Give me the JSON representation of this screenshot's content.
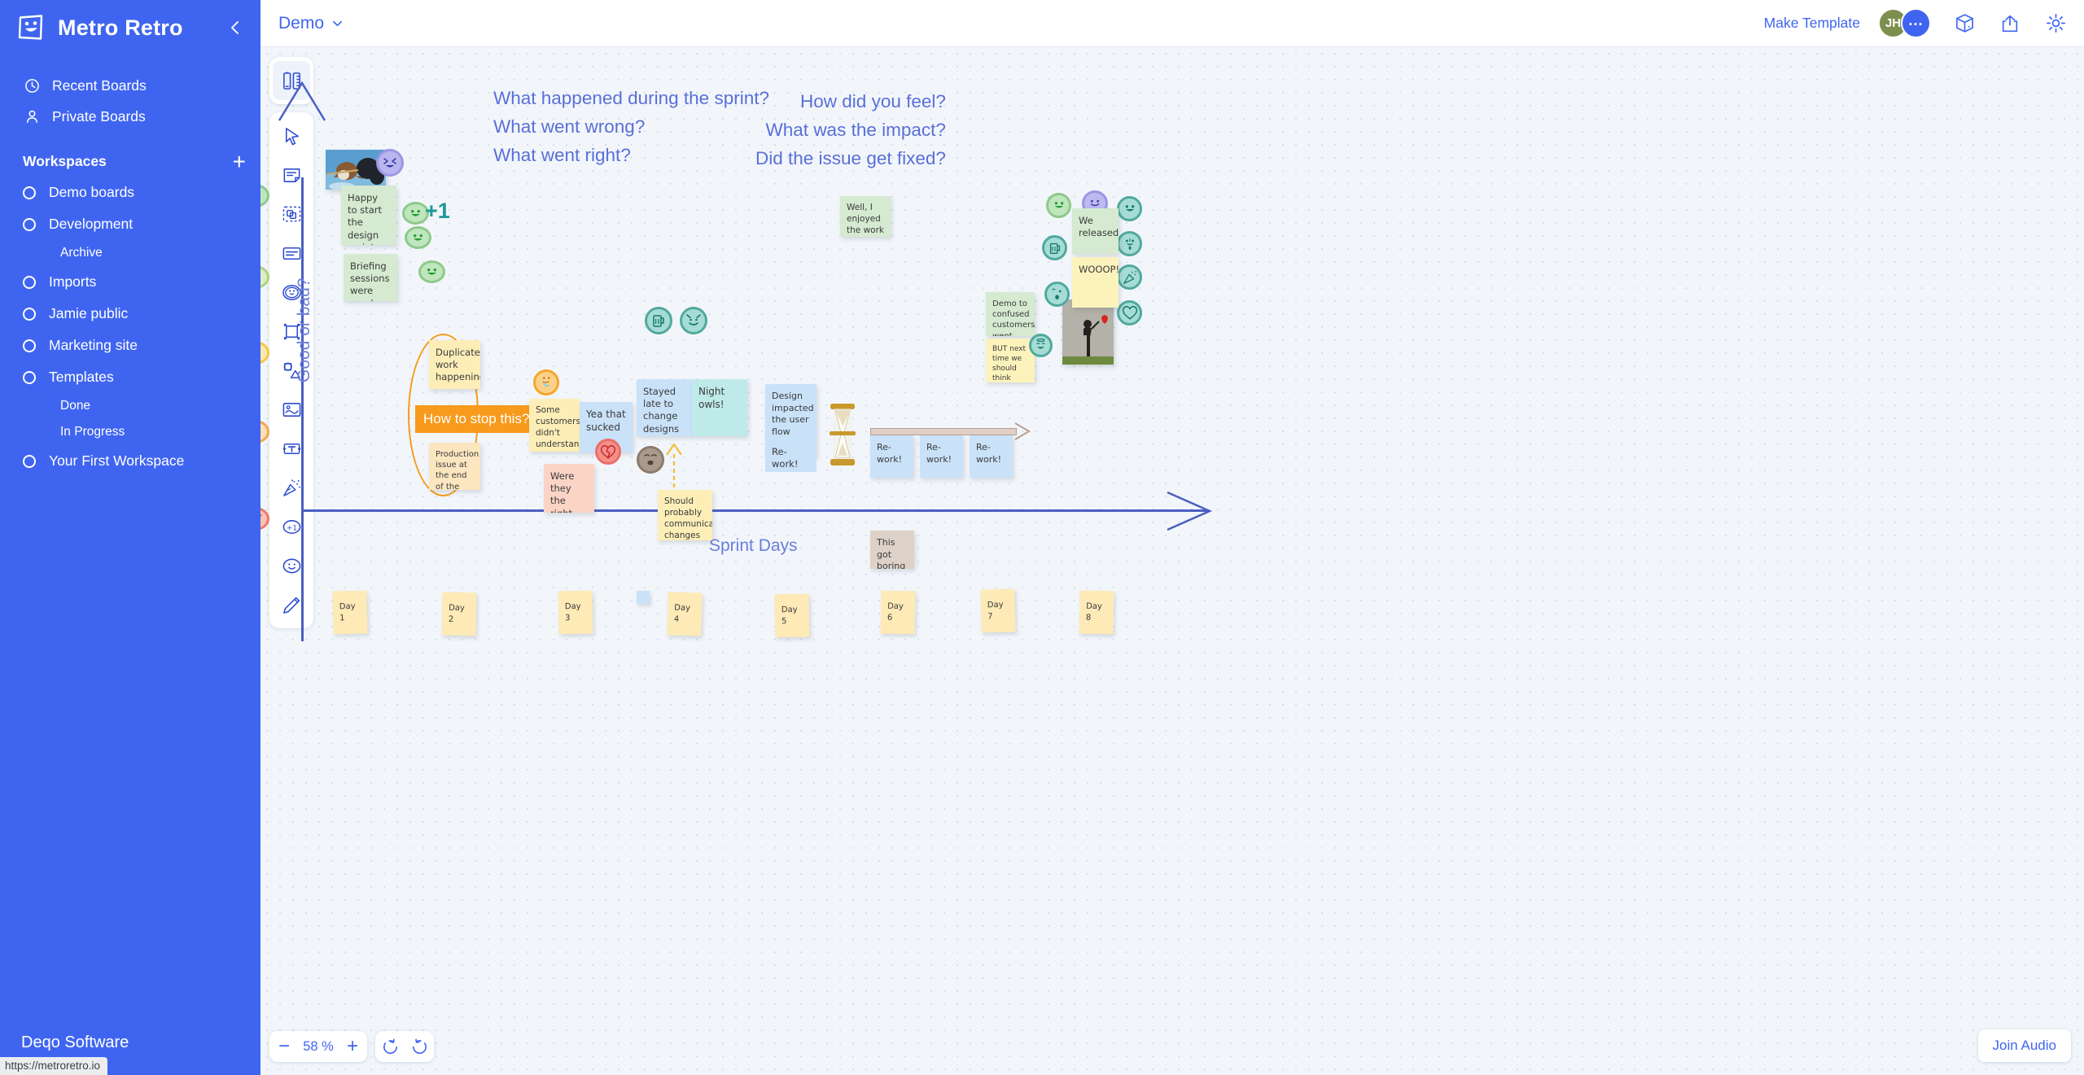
{
  "sidebar": {
    "app_title": "Metro Retro",
    "logo_icon": "smiley-note-icon",
    "collapse_icon": "chevron-left-icon",
    "nav": [
      {
        "label": "Recent Boards",
        "icon": "clock-icon"
      },
      {
        "label": "Private Boards",
        "icon": "person-icon"
      }
    ],
    "workspaces_heading": "Workspaces",
    "add_icon": "plus-icon",
    "workspaces": [
      {
        "label": "Demo boards",
        "sub": []
      },
      {
        "label": "Development",
        "sub": [
          "Archive"
        ]
      },
      {
        "label": "Imports",
        "sub": []
      },
      {
        "label": "Jamie public",
        "sub": []
      },
      {
        "label": "Marketing site",
        "sub": []
      },
      {
        "label": "Templates",
        "sub": [
          "Done",
          "In Progress"
        ]
      },
      {
        "label": "Your First Workspace",
        "sub": []
      }
    ],
    "footer_label": "Deqo Software",
    "status_url": "https://metroretro.io"
  },
  "topbar": {
    "board_name": "Demo",
    "board_chevron_icon": "chevron-down-icon",
    "make_template_label": "Make Template",
    "avatar_initials": "JH",
    "avatar_more": "...",
    "icons": [
      "box-icon",
      "share-icon",
      "gear-icon"
    ]
  },
  "toolbar": {
    "groups": [
      [
        {
          "name": "pen-ruler-icon",
          "active": true
        }
      ],
      [
        {
          "name": "cursor-icon"
        },
        {
          "name": "sticky-note-icon"
        },
        {
          "name": "select-shapes-icon"
        },
        {
          "name": "card-icon"
        },
        {
          "name": "emoji-stamp-icon"
        },
        {
          "name": "frame-icon"
        },
        {
          "name": "shapes-icon"
        },
        {
          "name": "image-icon"
        },
        {
          "name": "text-icon"
        },
        {
          "name": "confetti-icon"
        },
        {
          "name": "plus-one-vote-icon"
        },
        {
          "name": "reaction-icon"
        },
        {
          "name": "pencil-icon"
        }
      ]
    ]
  },
  "canvas": {
    "prompts": [
      {
        "id": "prompt-left",
        "text": "What happened during the sprint?\nWhat went wrong?\nWhat went right?",
        "align": "left"
      },
      {
        "id": "prompt-right",
        "text": "How did you feel?\nWhat was the impact?\nDid the issue get fixed?",
        "align": "right"
      }
    ],
    "axis_y_label": "Good or bad?",
    "axis_x_label": "Sprint Days",
    "mood_scale": [
      "happy-face",
      "smile-face",
      "neutral-face",
      "sad-face",
      "angry-face"
    ],
    "group_label": "How to stop this?",
    "plus_one_badge": "+1",
    "notes": [
      {
        "id": "n-happy-start",
        "text": "Happy to start the design sprint",
        "color": "g"
      },
      {
        "id": "n-briefing",
        "text": "Briefing sessions were good",
        "color": "g"
      },
      {
        "id": "n-duplicate",
        "text": "Duplicate work happening",
        "color": "y"
      },
      {
        "id": "n-production",
        "text": "Production issue at the end of the day",
        "color": "y2"
      },
      {
        "id": "n-some-customers",
        "text": "Some customers didn't understand",
        "color": "y"
      },
      {
        "id": "n-yea-sucked",
        "text": "Yea that sucked",
        "color": "b"
      },
      {
        "id": "n-right-persona",
        "text": "Were they the right persona?",
        "color": "p"
      },
      {
        "id": "n-stayed-late",
        "text": "Stayed late to change designs",
        "color": "b"
      },
      {
        "id": "n-night-owls",
        "text": "Night owls!",
        "color": "b2"
      },
      {
        "id": "n-communicate",
        "text": "Should probably communicate changes better",
        "color": "y"
      },
      {
        "id": "n-design-impacted",
        "text": "Design impacted the user flow",
        "color": "b"
      },
      {
        "id": "n-rework-0",
        "text": "Re-work!",
        "color": "b"
      },
      {
        "id": "n-rework-1",
        "text": "Re-work!",
        "color": "b"
      },
      {
        "id": "n-rework-2",
        "text": "Re-work!",
        "color": "b"
      },
      {
        "id": "n-rework-3",
        "text": "Re-work!",
        "color": "b"
      },
      {
        "id": "n-boring",
        "text": "This got boring",
        "color": "br"
      },
      {
        "id": "n-enjoyed",
        "text": "Well, I enjoyed the work",
        "color": "g"
      },
      {
        "id": "n-released",
        "text": "We released!",
        "color": "g"
      },
      {
        "id": "n-wooop",
        "text": "WOOOP!!!",
        "color": "ly"
      },
      {
        "id": "n-demo-confused",
        "text": "Demo to confused customers went well",
        "color": "g"
      },
      {
        "id": "n-but-next-time",
        "text": "BUT next time we should think about making content earlier",
        "color": "ly"
      }
    ],
    "day_notes": [
      "Day 1",
      "Day 2",
      "Day 3",
      "Day 4",
      "Day 5",
      "Day 6",
      "Day 7",
      "Day 8"
    ],
    "images": [
      {
        "id": "img-dogs",
        "alt": "two dogs playing with stick in water"
      },
      {
        "id": "img-hourglass",
        "alt": "golden hourglass"
      },
      {
        "id": "img-balloon-girl",
        "alt": "girl with red heart balloon street art"
      }
    ]
  },
  "bottom": {
    "zoom_out_icon": "minus-icon",
    "zoom_value": "58 %",
    "zoom_in_icon": "plus-icon",
    "undo_icon": "undo-icon",
    "redo_icon": "redo-icon",
    "join_audio_label": "Join Audio"
  },
  "colors": {
    "brand_blue": "#3f65f0",
    "canvas_bg": "#f2f6fb",
    "axis": "#4a5fc1",
    "group_orange": "#f89a1c",
    "accent_teal": "#1b9a9a"
  }
}
